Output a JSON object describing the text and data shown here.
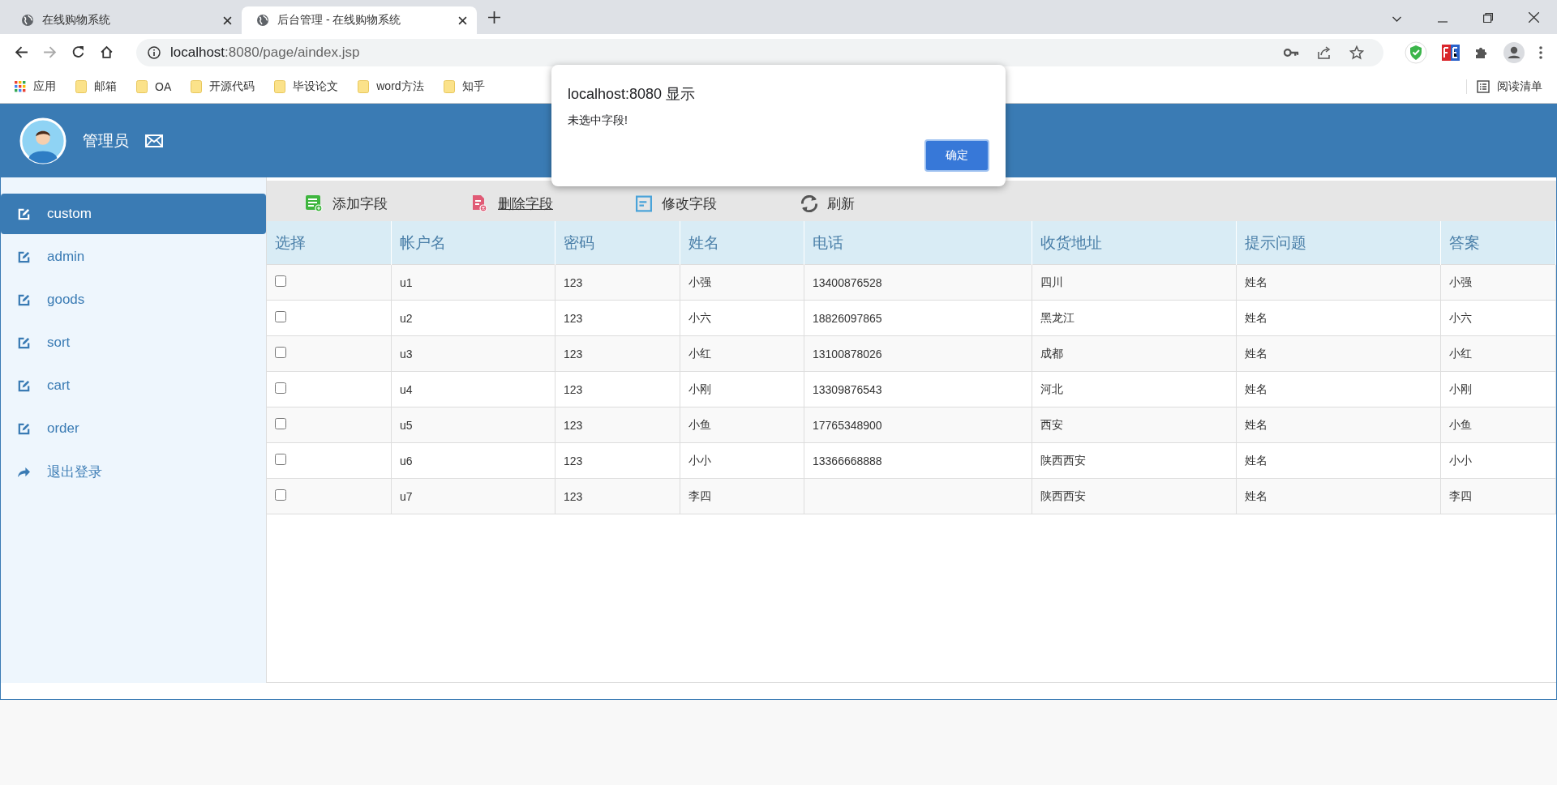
{
  "browser": {
    "tabs": [
      {
        "title": "在线购物系统",
        "selected": false
      },
      {
        "title": "后台管理 - 在线购物系统",
        "selected": true
      }
    ],
    "url_host": "localhost",
    "url_rest": ":8080/page/aindex.jsp",
    "bookmarks": [
      {
        "label": "应用",
        "kind": "apps"
      },
      {
        "label": "邮箱",
        "kind": "folder"
      },
      {
        "label": "OA",
        "kind": "folder"
      },
      {
        "label": "开源代码",
        "kind": "folder"
      },
      {
        "label": "毕设论文",
        "kind": "folder"
      },
      {
        "label": "word方法",
        "kind": "folder"
      },
      {
        "label": "知乎",
        "kind": "folder"
      }
    ],
    "reading_list": "阅读清单"
  },
  "header": {
    "user": "管理员"
  },
  "sidebar": {
    "items": [
      {
        "label": "custom",
        "kind": "edit",
        "selected": true
      },
      {
        "label": "admin",
        "kind": "edit",
        "selected": false
      },
      {
        "label": "goods",
        "kind": "edit",
        "selected": false
      },
      {
        "label": "sort",
        "kind": "edit",
        "selected": false
      },
      {
        "label": "cart",
        "kind": "edit",
        "selected": false
      },
      {
        "label": "order",
        "kind": "edit",
        "selected": false
      },
      {
        "label": "退出登录",
        "kind": "logout",
        "selected": false
      }
    ]
  },
  "toolbar": [
    {
      "label": "添加字段",
      "kind": "add"
    },
    {
      "label": "删除字段",
      "kind": "delete"
    },
    {
      "label": "修改字段",
      "kind": "edit"
    },
    {
      "label": "刷新",
      "kind": "refresh"
    }
  ],
  "table": {
    "columns": [
      "选择",
      "帐户名",
      "密码",
      "姓名",
      "电话",
      "收货地址",
      "提示问题",
      "答案"
    ],
    "rows": [
      {
        "checked": false,
        "cells": [
          "",
          "u1",
          "123",
          "小强",
          "13400876528",
          "四川",
          "姓名",
          "小强"
        ]
      },
      {
        "checked": false,
        "cells": [
          "",
          "u2",
          "123",
          "小六",
          "18826097865",
          "黑龙江",
          "姓名",
          "小六"
        ]
      },
      {
        "checked": false,
        "cells": [
          "",
          "u3",
          "123",
          "小红",
          "13100878026",
          "成都",
          "姓名",
          "小红"
        ]
      },
      {
        "checked": false,
        "cells": [
          "",
          "u4",
          "123",
          "小刚",
          "13309876543",
          "河北",
          "姓名",
          "小刚"
        ]
      },
      {
        "checked": false,
        "cells": [
          "",
          "u5",
          "123",
          "小鱼",
          "17765348900",
          "西安",
          "姓名",
          "小鱼"
        ]
      },
      {
        "checked": false,
        "cells": [
          "",
          "u6",
          "123",
          "小小",
          "13366668888",
          "陕西西安",
          "姓名",
          "小小"
        ]
      },
      {
        "checked": false,
        "cells": [
          "",
          "u7",
          "123",
          "李四",
          "",
          "陕西西安",
          "姓名",
          "李四"
        ]
      }
    ]
  },
  "dialog": {
    "title": "localhost:8080 显示",
    "message": "未选中字段!",
    "ok": "确定"
  }
}
